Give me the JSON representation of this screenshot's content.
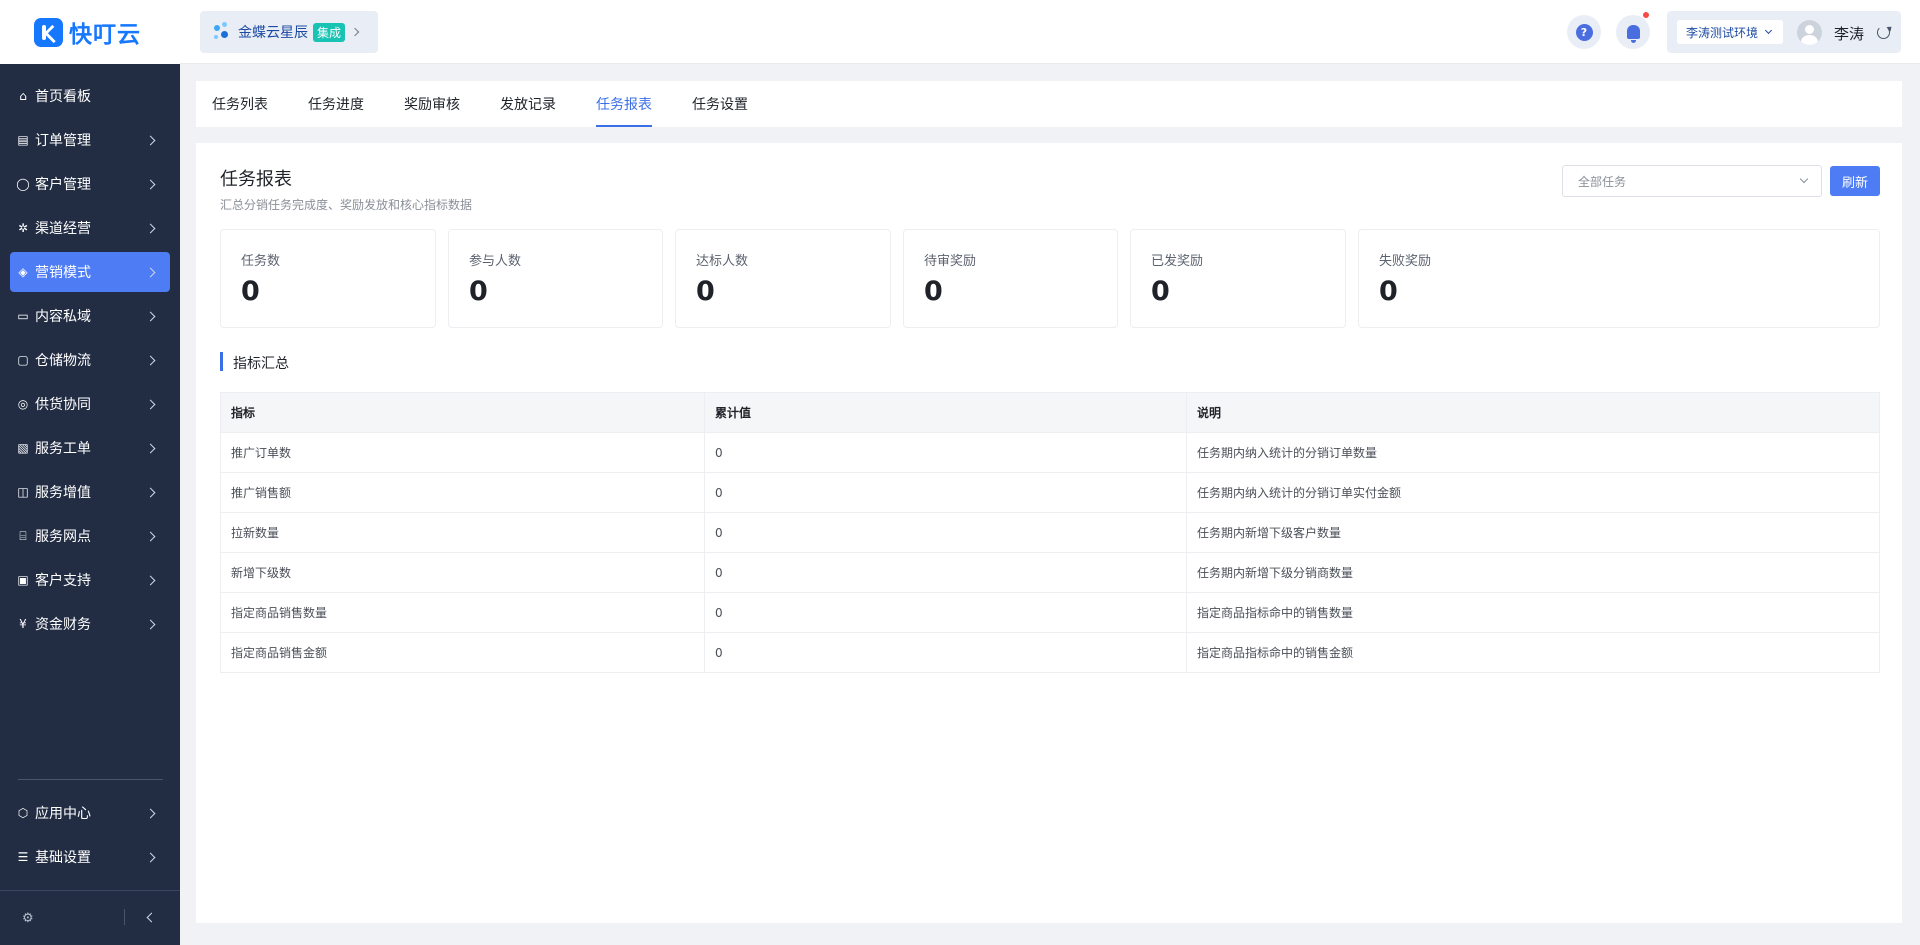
{
  "brand": {
    "name": "快叮云",
    "color": "#1677ff"
  },
  "org": {
    "name": "金蝶云星辰",
    "badge": "集成"
  },
  "header": {
    "env": "李涛测试环境",
    "user": "李涛",
    "help_symbol": "?"
  },
  "sidebar": {
    "items": [
      {
        "label": "首页看板",
        "icon": "home-icon",
        "glyph": "⌂",
        "chevron": false,
        "active": false
      },
      {
        "label": "订单管理",
        "icon": "order-icon",
        "glyph": "▤",
        "chevron": true,
        "active": false
      },
      {
        "label": "客户管理",
        "icon": "user-icon",
        "glyph": "◯",
        "chevron": true,
        "active": false
      },
      {
        "label": "渠道经营",
        "icon": "channel-icon",
        "glyph": "✲",
        "chevron": true,
        "active": false
      },
      {
        "label": "营销模式",
        "icon": "tag-icon",
        "glyph": "◈",
        "chevron": true,
        "active": true
      },
      {
        "label": "内容私域",
        "icon": "image-icon",
        "glyph": "▭",
        "chevron": true,
        "active": false
      },
      {
        "label": "仓储物流",
        "icon": "box-icon",
        "glyph": "▢",
        "chevron": true,
        "active": false
      },
      {
        "label": "供货协同",
        "icon": "supply-icon",
        "glyph": "◎",
        "chevron": true,
        "active": false
      },
      {
        "label": "服务工单",
        "icon": "ticket-icon",
        "glyph": "▧",
        "chevron": true,
        "active": false
      },
      {
        "label": "服务增值",
        "icon": "bag-icon",
        "glyph": "◫",
        "chevron": true,
        "active": false
      },
      {
        "label": "服务网点",
        "icon": "store-icon",
        "glyph": "⌸",
        "chevron": true,
        "active": false
      },
      {
        "label": "客户支持",
        "icon": "support-icon",
        "glyph": "▣",
        "chevron": true,
        "active": false
      },
      {
        "label": "资金财务",
        "icon": "yen-icon",
        "glyph": "¥",
        "chevron": true,
        "active": false
      }
    ],
    "bottom_items": [
      {
        "label": "应用中心",
        "icon": "cube-icon",
        "glyph": "⬡",
        "chevron": true
      },
      {
        "label": "基础设置",
        "icon": "sliders-icon",
        "glyph": "☰",
        "chevron": true
      }
    ],
    "footer_glyph": "⚙"
  },
  "tabs": [
    {
      "label": "任务列表",
      "active": false
    },
    {
      "label": "任务进度",
      "active": false
    },
    {
      "label": "奖励审核",
      "active": false
    },
    {
      "label": "发放记录",
      "active": false
    },
    {
      "label": "任务报表",
      "active": true
    },
    {
      "label": "任务设置",
      "active": false
    }
  ],
  "page": {
    "title": "任务报表",
    "subtitle": "汇总分销任务完成度、奖励发放和核心指标数据",
    "filter_value": "全部任务",
    "refresh_label": "刷新"
  },
  "stats": [
    {
      "label": "任务数",
      "value": "0"
    },
    {
      "label": "参与人数",
      "value": "0"
    },
    {
      "label": "达标人数",
      "value": "0"
    },
    {
      "label": "待审奖励",
      "value": "0"
    },
    {
      "label": "已发奖励",
      "value": "0"
    },
    {
      "label": "失败奖励",
      "value": "0"
    }
  ],
  "metrics": {
    "section_title": "指标汇总",
    "columns": [
      "指标",
      "累计值",
      "说明"
    ],
    "rows": [
      [
        "推广订单数",
        "0",
        "任务期内纳入统计的分销订单数量"
      ],
      [
        "推广销售额",
        "0",
        "任务期内纳入统计的分销订单实付金额"
      ],
      [
        "拉新数量",
        "0",
        "任务期内新增下级客户数量"
      ],
      [
        "新增下级数",
        "0",
        "任务期内新增下级分销商数量"
      ],
      [
        "指定商品销售数量",
        "0",
        "指定商品指标命中的销售数量"
      ],
      [
        "指定商品销售金额",
        "0",
        "指定商品指标命中的销售金额"
      ]
    ]
  }
}
